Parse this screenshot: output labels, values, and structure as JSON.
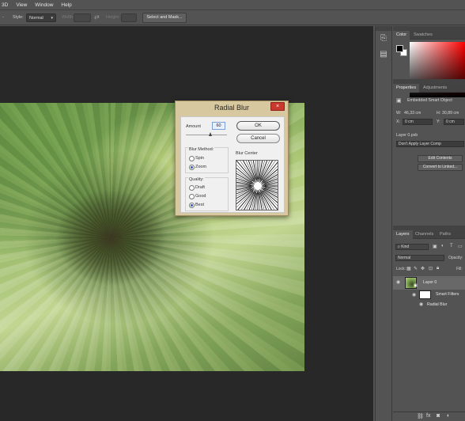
{
  "menubar": {
    "items": [
      "3D",
      "View",
      "Window",
      "Help"
    ]
  },
  "options": {
    "style_label": "Style:",
    "style_value": "Normal",
    "width_label": "Width:",
    "height_label": "Height:",
    "select_mask_label": "Select and Mask..."
  },
  "dialog": {
    "title": "Radial Blur",
    "close_glyph": "×",
    "amount_label": "Amount",
    "amount_value": "60",
    "ok_label": "OK",
    "cancel_label": "Cancel",
    "blur_method_label": "Blur Method:",
    "spin_label": "Spin",
    "zoom_label": "Zoom",
    "blur_method_selected": "Zoom",
    "quality_label": "Quality:",
    "draft_label": "Draft",
    "good_label": "Good",
    "best_label": "Best",
    "quality_selected": "Best",
    "blur_center_label": "Blur Center"
  },
  "color_panel": {
    "tabs": [
      "Color",
      "Swatches"
    ],
    "foreground": "#000000",
    "background": "#ffffff"
  },
  "properties_panel": {
    "tabs": [
      "Properties",
      "Adjustments"
    ],
    "object_type": "Embedded Smart Object",
    "w_label": "W:",
    "w_value": "46,33 cm",
    "h_label": "H:",
    "h_value": "30,89 cm",
    "x_label": "X:",
    "x_value": "0 cm",
    "y_label": "Y:",
    "y_value": "0 cm",
    "source_file": "Layer 0.psb",
    "comp_value": "Don't Apply Layer Comp",
    "edit_contents_label": "Edit Contents",
    "convert_label": "Convert to Linked..."
  },
  "layers_panel": {
    "tabs": [
      "Layers",
      "Channels",
      "Paths"
    ],
    "kind_label": "Kind",
    "blend_mode": "Normal",
    "opacity_label": "Opacity:",
    "lock_label": "Lock:",
    "fill_label": "Fill:",
    "layers": [
      {
        "name": "Layer 0",
        "level": 0
      },
      {
        "name": "Smart Filters",
        "level": 1
      },
      {
        "name": "Radial Blur",
        "level": 2
      }
    ]
  },
  "bottom_bar_icons": [
    "link-icon",
    "fx-icon",
    "mask-icon",
    "adjustment-icon"
  ],
  "colors": {
    "ui_dark": "#535353",
    "workspace": "#282828",
    "dialog_frame": "#d8c8a0",
    "close_red": "#c8382c"
  }
}
